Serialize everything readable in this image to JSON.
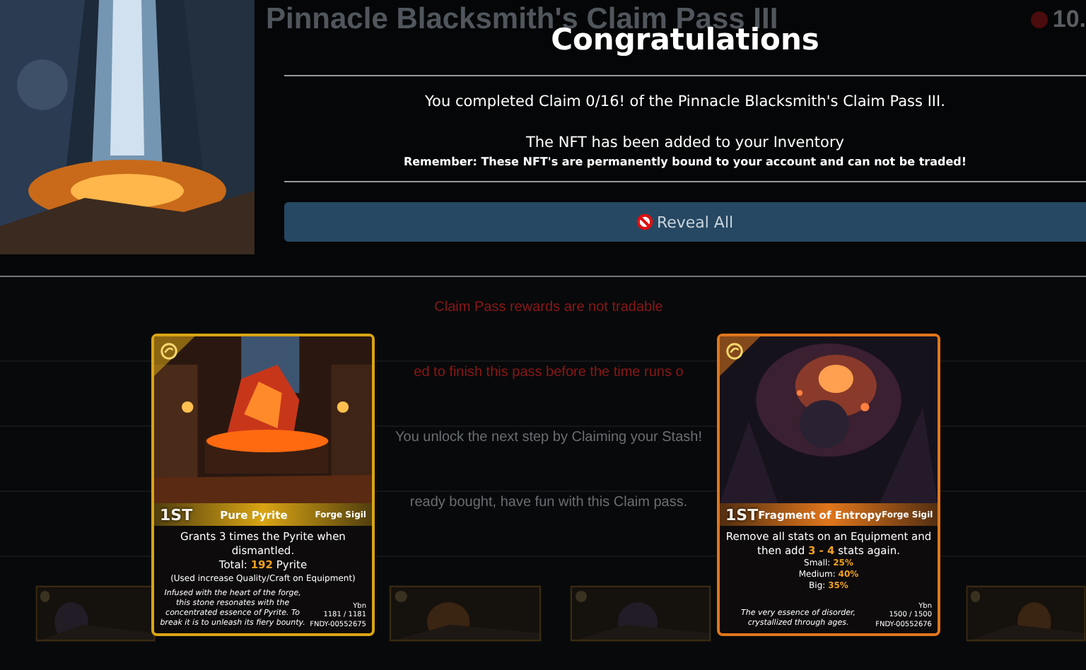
{
  "background": {
    "title": "Pinnacle Blacksmith's Claim Pass III",
    "balance": "10.",
    "notices": [
      {
        "text": "Claim Pass rewards are not tradable",
        "kind": "alert"
      },
      {
        "text": "ed to finish this pass before the time runs o",
        "kind": "alert"
      },
      {
        "text": "You unlock the next step by Claiming your Stash!",
        "kind": "info"
      },
      {
        "text": "ready bought, have fun with this Claim pass.",
        "kind": "info"
      }
    ]
  },
  "modal": {
    "title": "Congratulations",
    "message": "You completed Claim 0/16! of the Pinnacle Blacksmith's Claim Pass III.",
    "note": "The NFT has been added to your Inventory",
    "warning": "Remember: These NFT's are permanently bound to your account and can not be traded!",
    "button": {
      "label": "Reveal All",
      "disabled": true
    }
  },
  "cards": [
    {
      "rank": "1ST",
      "name": "Pure Pyrite",
      "type": "Forge Sigil",
      "color": "#d9a514",
      "lines": [
        {
          "kind": "main",
          "text": "Grants 3 times the Pyrite when dismantled."
        },
        {
          "kind": "main",
          "text": "Total:  **192**  Pyrite"
        },
        {
          "kind": "small",
          "text": "(Used increase Quality/Craft on Equipment)"
        }
      ],
      "lore": "Infused with the heart of the forge, this stone resonates with the concentrated essence of Pyrite. To break it is to unleash its fiery bounty.",
      "owner": "Ybn",
      "supply": "1181 / 1181",
      "serial": "FNDY-00552675"
    },
    {
      "rank": "1ST",
      "name": "Fragment of Entropy",
      "type": "Forge Sigil",
      "color": "#e0761c",
      "lines": [
        {
          "kind": "main",
          "text": "Remove all stats on an Equipment and then add  **3 - 4**  stats again."
        },
        {
          "kind": "stat",
          "text": "Small:  **25%**"
        },
        {
          "kind": "stat",
          "text": "Medium:  **40%**"
        },
        {
          "kind": "stat",
          "text": "Big:  **35%**"
        }
      ],
      "lore": "The very essence of disorder, crystallized through ages.",
      "owner": "Ybn",
      "supply": "1500 / 1500",
      "serial": "FNDY-00552676"
    }
  ]
}
